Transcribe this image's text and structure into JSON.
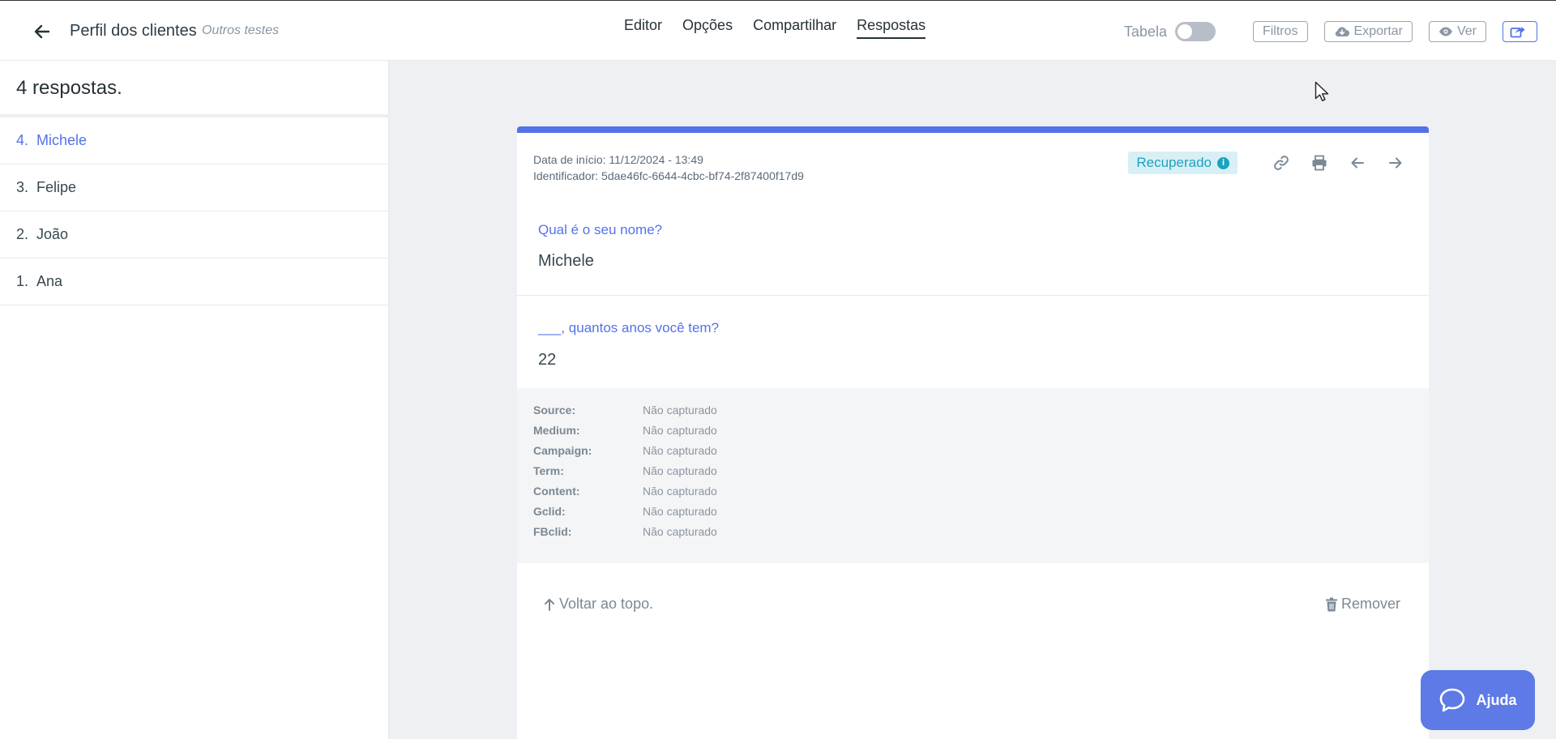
{
  "header": {
    "form_title": "Perfil dos clientes",
    "form_subtitle": "Outros testes",
    "tabs": [
      {
        "label": "Editor"
      },
      {
        "label": "Opções"
      },
      {
        "label": "Compartilhar"
      },
      {
        "label": "Respostas",
        "active": true
      }
    ],
    "table_toggle_label": "Tabela",
    "table_toggle_on": false,
    "filters_label": "Filtros",
    "export_label": "Exportar",
    "view_label": "Ver"
  },
  "sidebar": {
    "count_title": "4 respostas.",
    "items": [
      {
        "num": "4.",
        "name": "Michele",
        "active": true
      },
      {
        "num": "3.",
        "name": "Felipe"
      },
      {
        "num": "2.",
        "name": "João"
      },
      {
        "num": "1.",
        "name": "Ana"
      }
    ]
  },
  "response": {
    "start_date": "Data de início: 11/12/2024 - 13:49",
    "identifier": "Identificador: 5dae46fc-6644-4cbc-bf74-2f87400f17d9",
    "status_badge": "Recuperado",
    "status_info": "i",
    "questions": [
      {
        "question": "Qual é o seu nome?",
        "answer": "Michele"
      },
      {
        "question": "___, quantos anos você tem?",
        "answer": "22"
      }
    ],
    "utm": [
      {
        "key": "Source:",
        "value": "Não capturado"
      },
      {
        "key": "Medium:",
        "value": "Não capturado"
      },
      {
        "key": "Campaign:",
        "value": "Não capturado"
      },
      {
        "key": "Term:",
        "value": "Não capturado"
      },
      {
        "key": "Content:",
        "value": "Não capturado"
      },
      {
        "key": "Gclid:",
        "value": "Não capturado"
      },
      {
        "key": "FBclid:",
        "value": "Não capturado"
      }
    ],
    "back_to_top_label": "Voltar ao topo.",
    "remove_label": "Remover"
  },
  "help": {
    "label": "Ajuda"
  },
  "colors": {
    "accent": "#5472e8",
    "badge": "#1aa3c0",
    "help": "#5d7ae6"
  }
}
